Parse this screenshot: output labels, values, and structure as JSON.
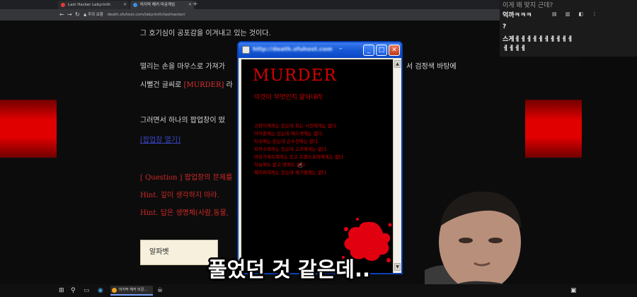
{
  "browser": {
    "tabs": [
      {
        "label": "Last Hacker Labyrinth",
        "favicon_color": "#e33b3b"
      },
      {
        "label": "마지막 해커 미궁게임",
        "favicon_color": "#3b8fe3"
      }
    ],
    "new_tab_label": "+",
    "nav": {
      "back": "←",
      "forward": "→",
      "reload": "↻",
      "home": "⌂"
    },
    "url_warning": "▲ 주의 요함",
    "url": "death.sfuhost.com/labyrinth/lasthacker/"
  },
  "page": {
    "lines": [
      {
        "text": "그 호기심이 공포감을 이겨내고 있는 것이다."
      },
      {
        "text": "떨리는 손을 마우스로 가져가"
      },
      {
        "text_a": "시뻘건 글씨로 ",
        "highlight": "[MURDER]",
        "text_b": " 라"
      },
      {
        "text": "서 검정색 바탕에"
      },
      {
        "text": "그러면서 하나의 팝업창이 떴"
      },
      {
        "text": "[팝업창 열기]"
      },
      {
        "text": "[ Question ] 팝업창의 문제를"
      },
      {
        "text": "Hint. 깊이 생각하지 마라."
      },
      {
        "text": "Hint. 답은 생명체(사람,동물,"
      }
    ],
    "answer": "알파벳",
    "accent_red": "#e00000"
  },
  "popup": {
    "title": "http://death.sfuhost.com",
    "title_suffix": "–",
    "buttons": {
      "minimize": "_",
      "maximize": "□",
      "close": "✕"
    },
    "heading": "MURDER",
    "subheading": "이것이 무엇인지 알아내라",
    "clues": [
      "고양이에게는 있는데 쥐는 시인에게는 없다.",
      "이어폰에는 있는데 헤드셋에는 없다.",
      "티슈에는 있는데 손수건에는 없다.",
      "피카소에게는 있는데 고흐에게는 없다.",
      "마징가제트에게는 있고 트랜스포머에게는 없다.",
      "하늘에도 없고 땅에도 없다.",
      "페이퍼에게는 있는데 제기랄에는 없다."
    ]
  },
  "chat": {
    "lines": [
      "이게 왜 맞지 근데?",
      "억까ㅋㅋㅋ",
      "?",
      "스게ㅔㅔㅔㅔㅔㅔㅔㅔㅔㅔ",
      "ㅔㅔㅔㅔ"
    ]
  },
  "subtitle": "풀었던 것 같은데..",
  "taskbar": {
    "start": "⊞",
    "search": "⚲",
    "app_label": "마지막 해커 미궁...",
    "clock": "▣"
  }
}
